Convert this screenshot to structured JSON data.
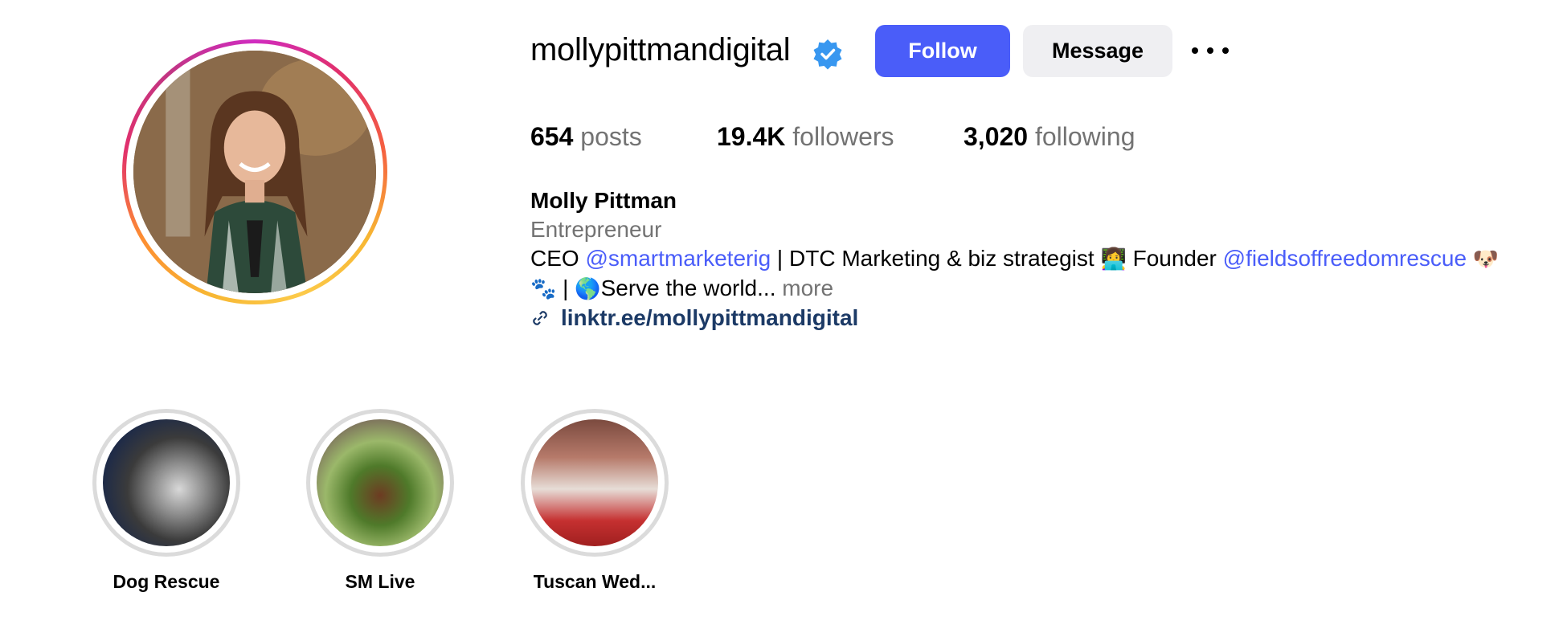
{
  "profile": {
    "username": "mollypittmandigital",
    "verified": true,
    "follow_label": "Follow",
    "message_label": "Message",
    "stats": {
      "posts_count": "654",
      "posts_label": "posts",
      "followers_count": "19.4K",
      "followers_label": "followers",
      "following_count": "3,020",
      "following_label": "following"
    },
    "bio": {
      "name": "Molly Pittman",
      "category": "Entrepreneur",
      "line1_a": "CEO ",
      "mention1": "@smartmarketerig",
      "line1_b": " | DTC Marketing & biz strategist ",
      "emoji1": "👩‍💻",
      "line1_c": " Founder ",
      "mention2": "@fieldsoffreedomrescue",
      "emoji2": "🐶",
      "emoji3": "🐾",
      "line2_a": " | ",
      "emoji4": "🌎",
      "line2_b": "Serve the world...",
      "more_label": "more",
      "link": "linktr.ee/mollypittmandigital"
    }
  },
  "highlights": [
    {
      "label": "Dog Rescue"
    },
    {
      "label": "SM Live"
    },
    {
      "label": "Tuscan Wed..."
    }
  ],
  "colors": {
    "accent": "#4a5df9",
    "verified": "#3897f0",
    "link": "#1c3a66",
    "secondary_text": "#737373"
  }
}
